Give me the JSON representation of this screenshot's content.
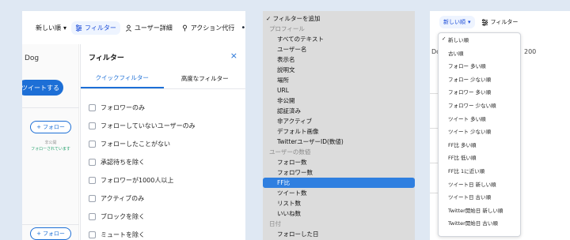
{
  "panel_a": {
    "toolbar": {
      "sort_label": "新しい順",
      "filter_label": "フィルター",
      "user_detail_label": "ユーザー詳細",
      "action_label": "アクション代行",
      "more_label": "•••"
    },
    "left": {
      "name_fragment": "Dog",
      "tweet_button": "ツイートする",
      "follow_button": "フォロー",
      "follow_button_2": "フォロー",
      "note_gray": "非公開",
      "note_green": "フォローされています"
    },
    "filter_panel": {
      "title": "フィルター",
      "close": "×",
      "tabs": [
        "クイックフィルター",
        "高度なフィルター"
      ],
      "options": [
        "フォロワーのみ",
        "フォローしていないユーザーのみ",
        "フォローしたことがない",
        "承認待ちを除く",
        "フォロワーが1000人以上",
        "アクティブのみ",
        "ブロックを除く",
        "ミュートを除く"
      ]
    }
  },
  "panel_b": {
    "add_filter": "フィルターを追加",
    "items": [
      {
        "text": "プロフィール",
        "kind": "hdr"
      },
      {
        "text": "すべてのテキスト",
        "kind": "opt"
      },
      {
        "text": "ユーザー名",
        "kind": "opt"
      },
      {
        "text": "表示名",
        "kind": "opt"
      },
      {
        "text": "説明文",
        "kind": "opt"
      },
      {
        "text": "場所",
        "kind": "opt"
      },
      {
        "text": "URL",
        "kind": "opt"
      },
      {
        "text": "非公開",
        "kind": "opt"
      },
      {
        "text": "認証済み",
        "kind": "opt"
      },
      {
        "text": "非アクティブ",
        "kind": "opt"
      },
      {
        "text": "デフォルト画像",
        "kind": "opt"
      },
      {
        "text": "TwitterユーザーID(数値)",
        "kind": "opt"
      },
      {
        "text": "ユーザーの数値",
        "kind": "hdr"
      },
      {
        "text": "フォロー数",
        "kind": "opt"
      },
      {
        "text": "フォロワー数",
        "kind": "opt"
      },
      {
        "text": "FF比",
        "kind": "opt",
        "selected": true
      },
      {
        "text": "ツイート数",
        "kind": "opt"
      },
      {
        "text": "リスト数",
        "kind": "opt"
      },
      {
        "text": "いいね数",
        "kind": "opt"
      },
      {
        "text": "日付",
        "kind": "hdr"
      },
      {
        "text": "フォローした日",
        "kind": "opt"
      }
    ]
  },
  "panel_c": {
    "sort_label": "新しい順",
    "filter_label": "フィルター",
    "bg_frag_1": "Do",
    "bg_frag_2": "200",
    "sort_options": [
      {
        "text": "新しい順",
        "checked": true
      },
      {
        "text": "古い順"
      },
      {
        "text": "フォロー 多い順"
      },
      {
        "text": "フォロー 少ない順"
      },
      {
        "text": "フォロワー 多い順"
      },
      {
        "text": "フォロワー 少ない順"
      },
      {
        "text": "ツイート 多い順"
      },
      {
        "text": "ツイート 少ない順"
      },
      {
        "text": "FF比 多い順"
      },
      {
        "text": "FF比 低い順"
      },
      {
        "text": "FF比 1に近い順"
      },
      {
        "text": "ツイート日 新しい順"
      },
      {
        "text": "ツイート日 古い順"
      },
      {
        "text": "Twitter開始日 新しい順"
      },
      {
        "text": "Twitter開始日 古い順"
      }
    ]
  },
  "colors": {
    "accent": "#1d6fd6",
    "selected_bg": "#2f7fe0",
    "page_bg": "#dfe8f3",
    "success": "#22a06b"
  }
}
